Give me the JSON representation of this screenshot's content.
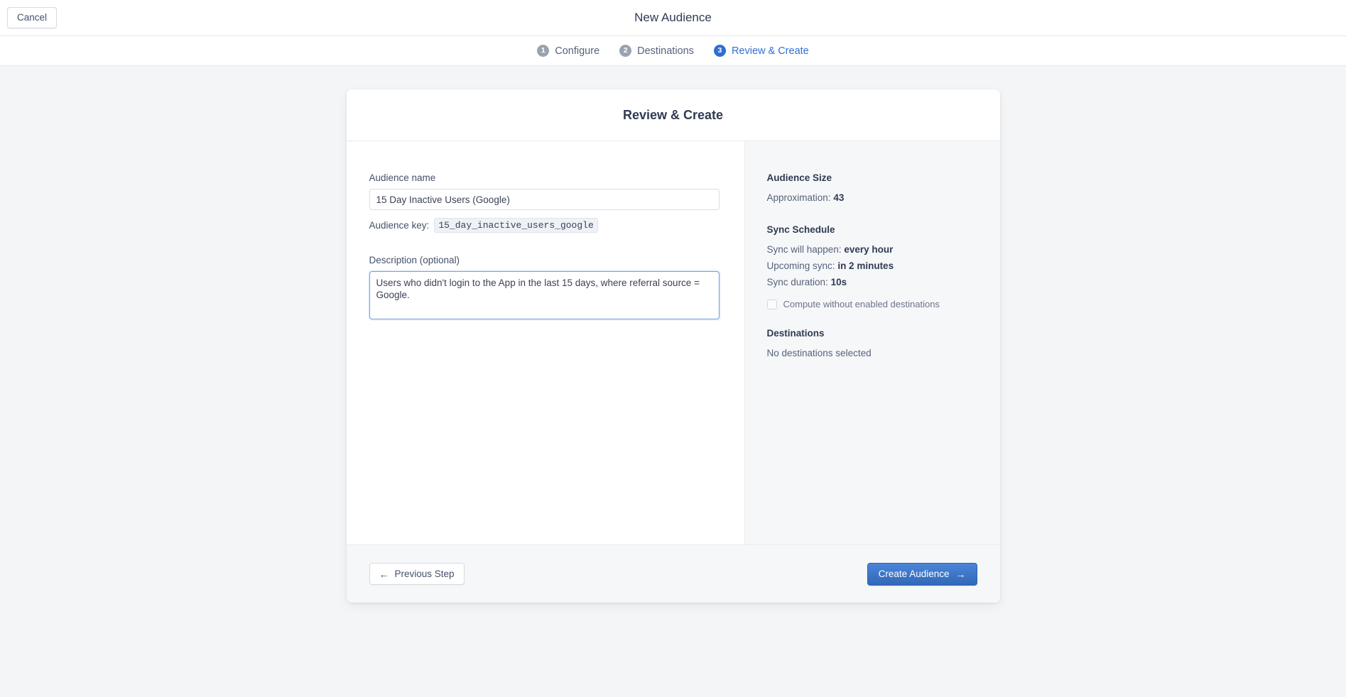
{
  "topbar": {
    "cancel_label": "Cancel",
    "title": "New Audience"
  },
  "stepper": {
    "steps": [
      {
        "num": "1",
        "label": "Configure",
        "active": false
      },
      {
        "num": "2",
        "label": "Destinations",
        "active": false
      },
      {
        "num": "3",
        "label": "Review & Create",
        "active": true
      }
    ]
  },
  "card": {
    "title": "Review & Create"
  },
  "form": {
    "audience_name_label": "Audience name",
    "audience_name_value": "15 Day Inactive Users (Google)",
    "audience_name_placeholder": "Audience name",
    "audience_key_label": "Audience key:",
    "audience_key_value": "15_day_inactive_users_google",
    "description_label": "Description (optional)",
    "description_value": "Users who didn't login to the App in the last 15 days, where referral source = Google.",
    "description_placeholder": "Description (optional)"
  },
  "summary": {
    "audience_size": {
      "heading": "Audience Size",
      "approximation_label": "Approximation:",
      "approximation_value": "43"
    },
    "sync_schedule": {
      "heading": "Sync Schedule",
      "sync_will_happen_label": "Sync will happen:",
      "sync_will_happen_value": "every hour",
      "upcoming_sync_label": "Upcoming sync:",
      "upcoming_sync_value": "in 2 minutes",
      "sync_duration_label": "Sync duration:",
      "sync_duration_value": "10s",
      "compute_checkbox_label": "Compute without enabled destinations",
      "compute_checkbox_checked": false
    },
    "destinations": {
      "heading": "Destinations",
      "empty_text": "No destinations selected"
    }
  },
  "footer": {
    "previous_label": "Previous Step",
    "previous_arrow": "←",
    "create_label": "Create Audience",
    "create_arrow": "→"
  },
  "colors": {
    "accent_blue": "#2f6fd0",
    "primary_button": "#3268b8",
    "page_background": "#f4f5f7",
    "panel_background": "#f6f7f9",
    "step_inactive": "#9aa3b0"
  }
}
